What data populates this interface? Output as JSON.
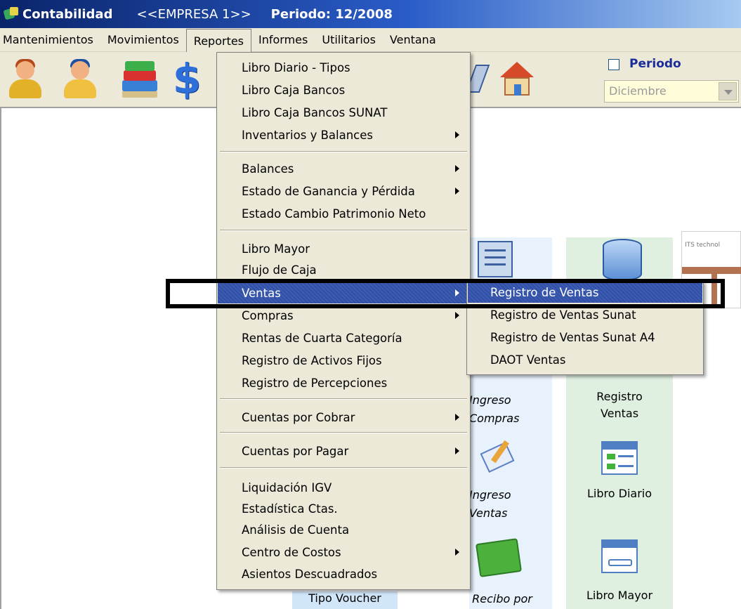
{
  "titlebar": {
    "app_name": "Contabilidad",
    "company": "<<EMPRESA 1>>",
    "period": "Periodo: 12/2008"
  },
  "menubar": {
    "items": [
      "Mantenimientos",
      "Movimientos",
      "Reportes",
      "Informes",
      "Utilitarios",
      "Ventana"
    ]
  },
  "toolbar": {
    "icons": [
      "user-icon",
      "user-blue-icon",
      "books-icon",
      "dollar-icon",
      "folder-icon",
      "house-icon"
    ],
    "dollar_glyph": "$",
    "periodo_label": "Periodo",
    "periodo_checked": false,
    "periodo_value": "Diciembre"
  },
  "reportes_menu": {
    "items": [
      {
        "label": "Libro Diario - Tipos"
      },
      {
        "label": "Libro Caja Bancos"
      },
      {
        "label": "Libro Caja Bancos SUNAT"
      },
      {
        "label": "Inventarios y Balances",
        "submenu": true
      },
      {
        "label": "Balances",
        "submenu": true
      },
      {
        "label": "Estado de Ganancia y Pérdida",
        "submenu": true
      },
      {
        "label": "Estado Cambio Patrimonio Neto"
      },
      {
        "label": "Libro Mayor"
      },
      {
        "label": "Flujo de Caja"
      },
      {
        "label": "Ventas",
        "submenu": true,
        "highlighted": true
      },
      {
        "label": "Compras",
        "submenu": true
      },
      {
        "label": "Rentas de Cuarta Categoría"
      },
      {
        "label": "Registro de Activos Fijos"
      },
      {
        "label": "Registro de Percepciones"
      },
      {
        "label": "Cuentas por Cobrar",
        "submenu": true
      },
      {
        "label": "Cuentas por Pagar",
        "submenu": true
      },
      {
        "label": "Liquidación IGV"
      },
      {
        "label": "Estadística Ctas."
      },
      {
        "label": "Análisis de Cuenta"
      },
      {
        "label": "Centro de Costos",
        "submenu": true
      },
      {
        "label": "Asientos Descuadrados"
      }
    ]
  },
  "ventas_menu": {
    "items": [
      {
        "label": "Registro de Ventas",
        "highlighted": true
      },
      {
        "label": "Registro de Ventas Sunat"
      },
      {
        "label": "Registro de Ventas Sunat A4"
      },
      {
        "label": "DAOT Ventas"
      }
    ]
  },
  "desktop": {
    "ingreso_compras": "Ingreso\nCompras",
    "ingreso_ventas": "Ingreso\nVentas",
    "recibo_por": "Recibo por",
    "tipo_voucher": "Tipo Voucher",
    "registro_ventas": "Registro\nVentas",
    "libro_diario": "Libro Diario",
    "libro_mayor": "Libro Mayor",
    "its_text": "ITS technol"
  }
}
